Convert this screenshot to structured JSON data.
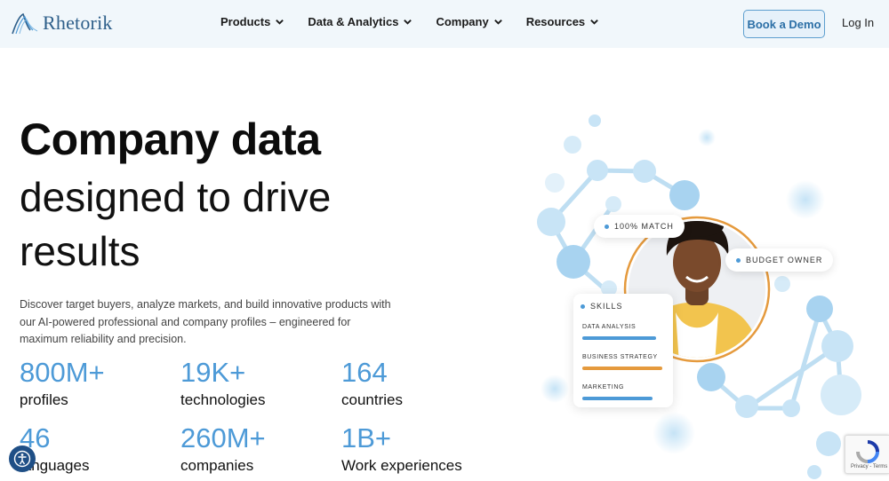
{
  "header": {
    "logo": "Rhetorik",
    "nav": [
      {
        "label": "Products"
      },
      {
        "label": "Data & Analytics"
      },
      {
        "label": "Company"
      },
      {
        "label": "Resources"
      }
    ],
    "book_demo": "Book a Demo",
    "login": "Log In"
  },
  "hero": {
    "title_bold": "Company data",
    "title_line2": "designed to drive",
    "title_line3": "results",
    "description": "Discover target buyers, analyze markets, and build innovative products with our AI-powered professional and company profiles – engineered for maximum reliability and precision."
  },
  "stats": [
    {
      "value": "800M+",
      "label": "profiles"
    },
    {
      "value": "19K+",
      "label": "technologies"
    },
    {
      "value": "164",
      "label": "countries"
    },
    {
      "value": "46",
      "label": "languages"
    },
    {
      "value": "260M+",
      "label": "companies"
    },
    {
      "value": "1B+",
      "label": "Work experiences"
    }
  ],
  "illustration": {
    "match_tag": "100% MATCH",
    "role_tag": "BUDGET OWNER",
    "skills_title": "SKILLS",
    "skills": [
      {
        "name": "DATA ANALYSIS",
        "color": "#4d9ad7",
        "level": 0.75
      },
      {
        "name": "BUSINESS STRATEGY",
        "color": "#e59a3d",
        "level": 0.82
      },
      {
        "name": "MARKETING",
        "color": "#4d9ad7",
        "level": 0.72
      }
    ]
  },
  "recaptcha": {
    "footer": "Privacy - Terms"
  },
  "colors": {
    "accent": "#4d9ad7",
    "brand": "#2e5f8a",
    "header_bg": "#f1f7fb"
  }
}
